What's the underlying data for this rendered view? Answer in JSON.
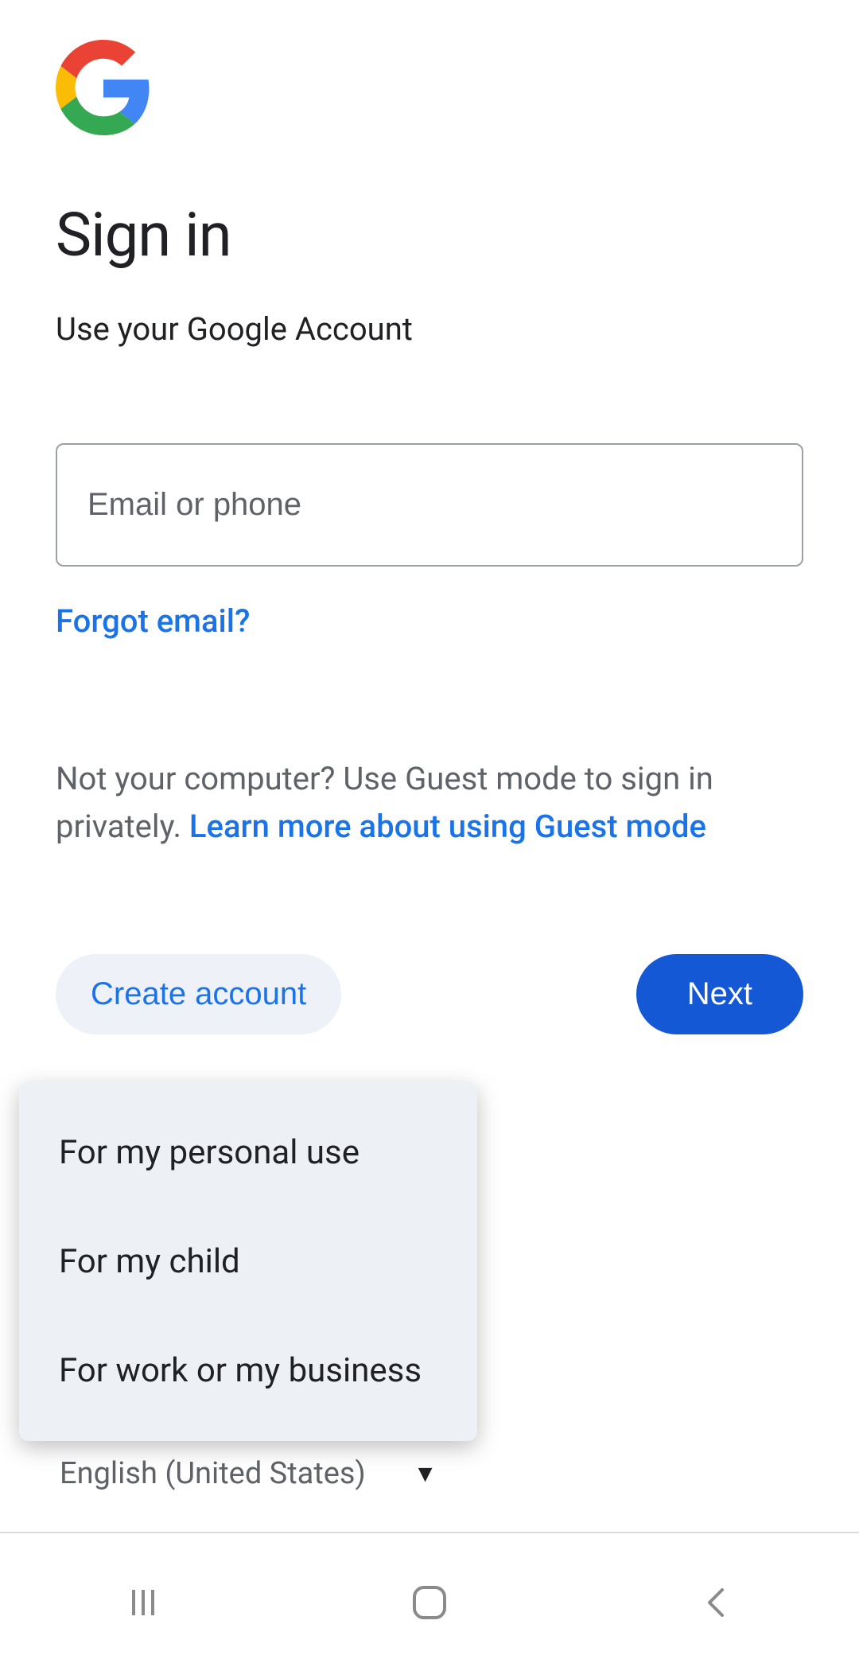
{
  "title": "Sign in",
  "subtitle": "Use your Google Account",
  "input": {
    "placeholder": "Email or phone"
  },
  "links": {
    "forgot_email": "Forgot email?",
    "guest_text": "Not your computer? Use Guest mode to sign in privately. ",
    "guest_link": "Learn more about using Guest mode"
  },
  "buttons": {
    "create_account": "Create account",
    "next": "Next"
  },
  "dropdown": {
    "items": [
      "For my personal use",
      "For my child",
      "For work or my business"
    ]
  },
  "language": "English (United States)"
}
